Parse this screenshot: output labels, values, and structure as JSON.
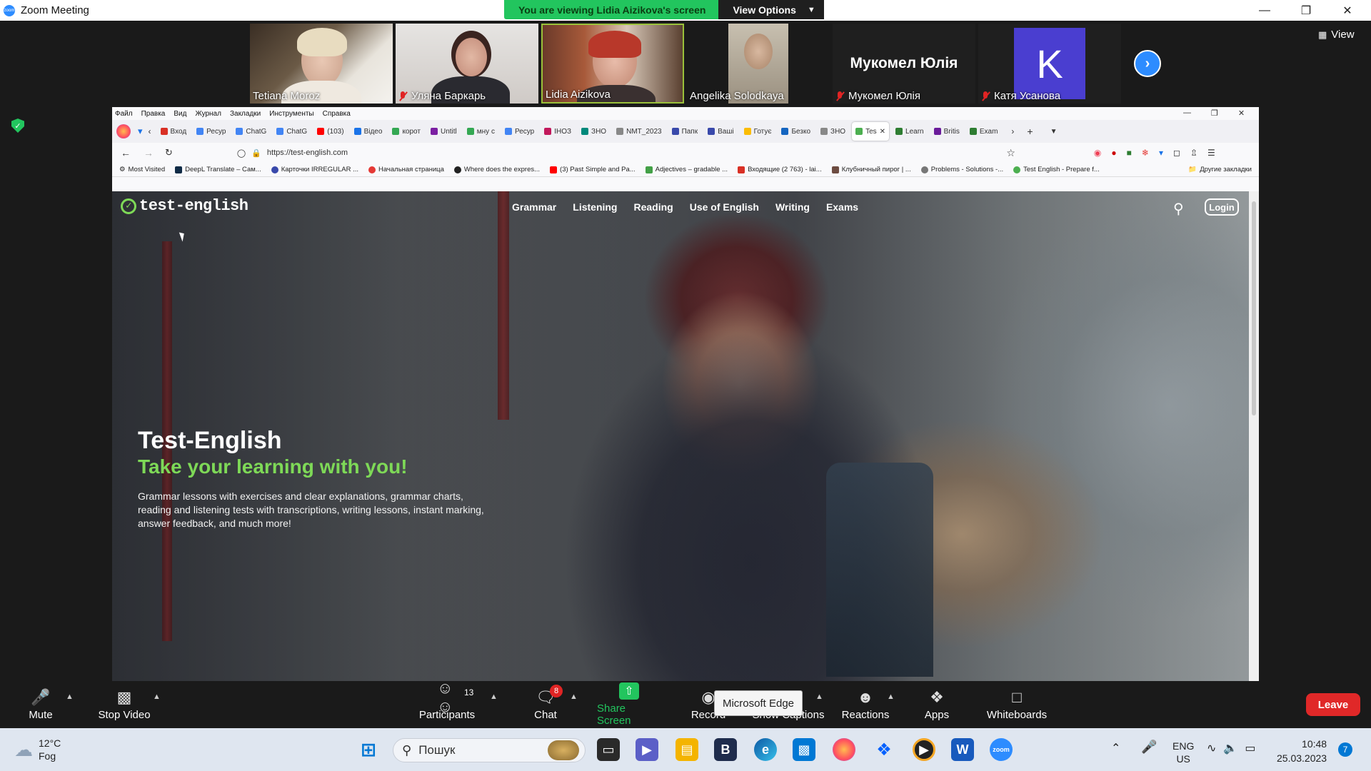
{
  "window": {
    "title": "Zoom Meeting"
  },
  "share_banner": {
    "message": "You are viewing Lidia Aizikova's screen",
    "options_label": "View Options"
  },
  "gallery": {
    "participants": [
      {
        "name": "Tetiana Moroz",
        "muted": false
      },
      {
        "name": "Уляна Баркарь",
        "muted": true
      },
      {
        "name": "Lidia Aizikova",
        "muted": false
      },
      {
        "name": "Angelika Solodkaya",
        "muted": false
      },
      {
        "name": "Мукомел Юлія",
        "display": "Мукомел Юлія",
        "muted": true
      },
      {
        "name": "Катя Усанова",
        "initial": "K",
        "muted": true
      }
    ],
    "view_label": "View"
  },
  "browser": {
    "menu": [
      "Файл",
      "Правка",
      "Вид",
      "Журнал",
      "Закладки",
      "Инструменты",
      "Справка"
    ],
    "tabs": [
      {
        "label": "Вход",
        "color": "#d93025"
      },
      {
        "label": "Ресур",
        "color": "#4285f4"
      },
      {
        "label": "ChatG",
        "color": "#4285f4"
      },
      {
        "label": "ChatG",
        "color": "#4285f4"
      },
      {
        "label": "(103)",
        "color": "#ff0000"
      },
      {
        "label": "Відео",
        "color": "#1a73e8"
      },
      {
        "label": "корот",
        "color": "#34a853"
      },
      {
        "label": "Untitl",
        "color": "#7b1fa2"
      },
      {
        "label": "мну с",
        "color": "#34a853"
      },
      {
        "label": "Ресур",
        "color": "#4285f4"
      },
      {
        "label": "ІНОЗ",
        "color": "#c2185b"
      },
      {
        "label": "ЗНО",
        "color": "#00897b"
      },
      {
        "label": "NMT_2023",
        "color": "#888888"
      },
      {
        "label": "Папк",
        "color": "#3949ab"
      },
      {
        "label": "Ваші",
        "color": "#3949ab"
      },
      {
        "label": "Готує",
        "color": "#fbbc04"
      },
      {
        "label": "Безко",
        "color": "#1565c0"
      },
      {
        "label": "ЗНО",
        "color": "#888888"
      },
      {
        "label": "Tes",
        "color": "#4caf50",
        "active": true
      },
      {
        "label": "Learn",
        "color": "#2e7d32"
      },
      {
        "label": "Britis",
        "color": "#6a1b9a"
      },
      {
        "label": "Exam",
        "color": "#2e7d32"
      }
    ],
    "url": "https://test-english.com",
    "bookmarks": [
      "Most Visited",
      "DeepL Translate – Сам...",
      "Карточки IRREGULAR ...",
      "Начальная страница",
      "Where does the expres...",
      "(3) Past Simple and Pa...",
      "Adjectives – gradable ...",
      "Входящие (2 763) - lai...",
      "Клубничный пирог | ...",
      "Problems - Solutions -...",
      "Test English - Prepare f..."
    ],
    "other_bookmarks": "Другие закладки"
  },
  "site": {
    "logo": "test-english",
    "nav": [
      "Grammar",
      "Listening",
      "Reading",
      "Use of English",
      "Writing",
      "Exams"
    ],
    "login": "Login",
    "hero_title": "Test-English",
    "hero_subtitle": "Take your learning with you!",
    "hero_desc": "Grammar lessons with exercises and clear explanations, grammar charts, reading and listening tests with transcriptions, writing lessons, instant marking, answer feedback, and much more!"
  },
  "toolbar": {
    "mute": "Mute",
    "stop_video": "Stop Video",
    "participants": "Participants",
    "participants_count": "13",
    "chat": "Chat",
    "chat_badge": "8",
    "share_screen": "Share Screen",
    "record": "Record",
    "show_captions": "Show Captions",
    "reactions": "Reactions",
    "apps": "Apps",
    "whiteboards": "Whiteboards",
    "leave": "Leave",
    "tooltip": "Microsoft Edge"
  },
  "taskbar": {
    "weather_temp": "12°C",
    "weather_desc": "Fog",
    "search_placeholder": "Пошук",
    "lang_top": "ENG",
    "lang_bottom": "US",
    "time": "10:48",
    "date": "25.03.2023",
    "notifications": "7"
  }
}
